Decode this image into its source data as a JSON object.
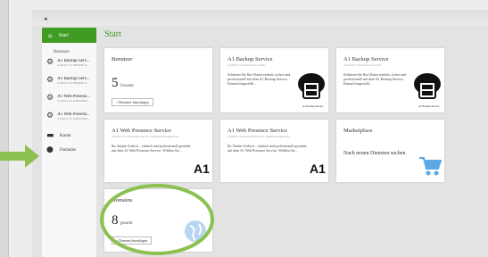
{
  "app": {
    "collapse_icon": "chevron-left-icon"
  },
  "sidebar": {
    "start_label": "Start",
    "users_heading": "Benutzer",
    "items": [
      {
        "label": "A1 Backup Serv...",
        "sub": "A1/00327-1/L BDSR7R7R..."
      },
      {
        "label": "A1 Backup Serv...",
        "sub": "A1/00327-1/L BDSR7R7R..."
      },
      {
        "label": "A1 Web Presenz...",
        "sub": "A1/00327-1/L WEB PRESE..."
      },
      {
        "label": "A1 Web Presenz...",
        "sub": "A1/00327-1/L WEB PRESE..."
      }
    ],
    "konto_label": "Konto",
    "domains_label": "Domains"
  },
  "main": {
    "title": "Start",
    "benutzer": {
      "title": "Benutzer",
      "count": "5",
      "count_label": "Gesamt",
      "button": "+ Benutzer hinzufügen"
    },
    "backup1": {
      "title": "A1 Backup Service",
      "sub": "A1/00327-1/L Backup Service 10GB",
      "body": "Schützen Sie Ihre Daten einfach, sicher und professionell mit dem A1 Backup Service. Einmal eingestellt...",
      "logo_text": "A1 Backup Service"
    },
    "backup2": {
      "title": "A1 Backup Service",
      "sub": "A1/00327-1/L Backup Service 10GB",
      "body": "Schützen Sie Ihre Daten einfach, sicher und professionell mit dem A1 Backup Service. Einmal eingestellt...",
      "logo_text": "A1 Backup Service"
    },
    "web1": {
      "title": "A1 Web Presence Service",
      "sub": "A1/00327-1/L Web Presence Service - Standardpaket/Langzeitcode",
      "body": "Ihr Online-Auftritt – einfach und professionell gestaltet mit dem A1 Web Presence Service. Wählen Sie...",
      "logo": "A1"
    },
    "web2": {
      "title": "A1 Web Presence Service",
      "sub": "A1/00327-1/L Web Presence Service - Business/Langzeitcode",
      "body": "Ihr Online-Auftritt – einfach und professionell gestaltet mit dem A1 Web Presence Service. Wählen Sie...",
      "logo": "A1"
    },
    "marketplace": {
      "title": "Marketplace",
      "body": "Nach neuen Diensten suchen"
    },
    "domains": {
      "title": "Domains",
      "count": "8",
      "count_label": "gesamt",
      "button": "+ Domain hinzufügen"
    }
  },
  "colors": {
    "accent": "#3f9b22",
    "highlight": "#8cc152",
    "cart": "#5aa9e6"
  }
}
